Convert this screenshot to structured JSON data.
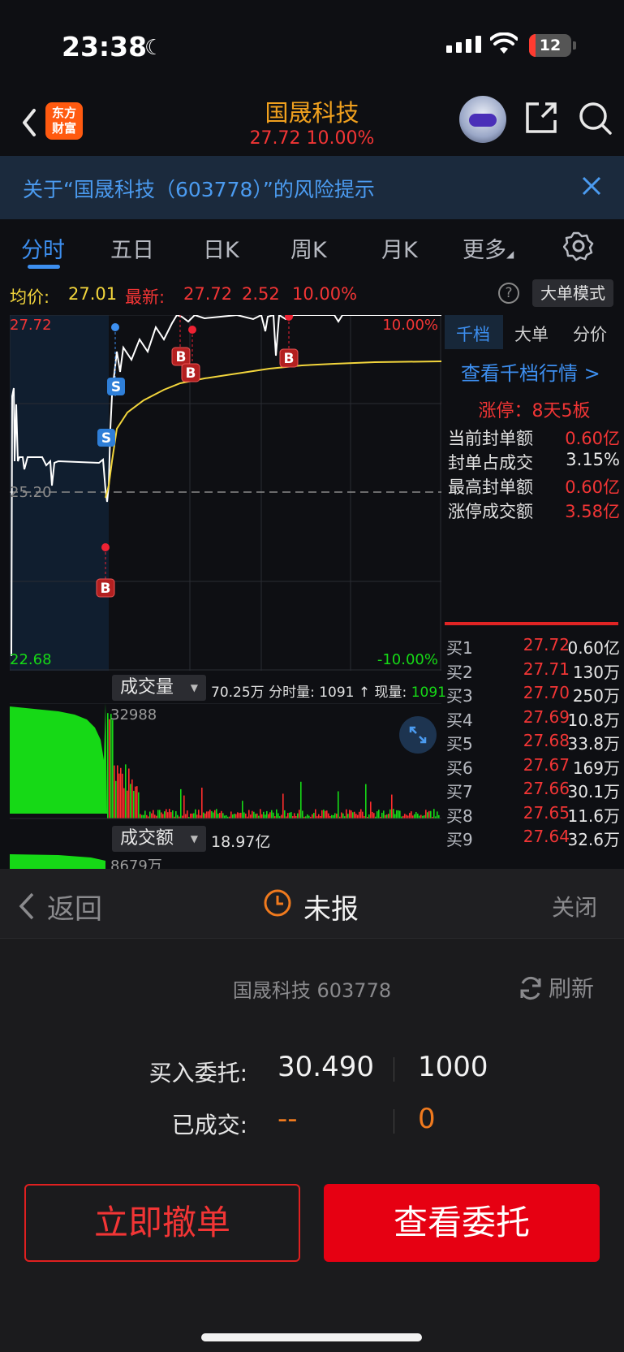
{
  "status_bar": {
    "time": "23:38",
    "battery": "12"
  },
  "nav": {
    "logo_line1": "东方",
    "logo_line2": "财富",
    "title": "国晟科技",
    "price_change": "27.72  10.00%"
  },
  "risk_banner": {
    "text": "关于“国晟科技（603778）”的风险提示"
  },
  "tabs": [
    {
      "label": "分时"
    },
    {
      "label": "五日"
    },
    {
      "label": "日K"
    },
    {
      "label": "周K"
    },
    {
      "label": "月K"
    },
    {
      "label": "更多"
    }
  ],
  "price_bar": {
    "avg_label": "均价:",
    "avg_value": "27.01",
    "latest_label": "最新:",
    "latest_value": "27.72",
    "change": "2.52",
    "pct": "10.00%",
    "help": "?",
    "mode_button": "大单模式"
  },
  "chart": {
    "high_price": "27.72",
    "high_pct": "10.00%",
    "ref_price": "25.20",
    "low_price": "22.68",
    "low_pct": "-10.00%",
    "colors": {
      "price_line": "#ffffff",
      "avg_line": "#f2d53c",
      "up": "#ff2d2d",
      "down": "#16d916"
    }
  },
  "volume": {
    "dropdown": "成交量",
    "total": "70.25万",
    "period_label": "分时量:",
    "period_value": "1091",
    "arrow": "↑",
    "now_label": "现量:",
    "now_value": "1091",
    "peak": "32988"
  },
  "amount": {
    "dropdown": "成交额",
    "total": "18.97亿",
    "peak": "8679万"
  },
  "right_panel": {
    "tabs": [
      "千档",
      "大单",
      "分价"
    ],
    "link": "查看千档行情 >",
    "limit_title": "涨停：8天5板",
    "stats": [
      {
        "k": "当前封单额",
        "v": "0.60亿",
        "red": true
      },
      {
        "k": "封单占成交",
        "v": "3.15%",
        "red": false
      },
      {
        "k": "最高封单额",
        "v": "0.60亿",
        "red": true
      },
      {
        "k": "涨停成交额",
        "v": "3.58亿",
        "red": true
      }
    ],
    "orderbook": [
      {
        "k": "买1",
        "p": "27.72",
        "q": "0.60亿"
      },
      {
        "k": "买2",
        "p": "27.71",
        "q": "130万"
      },
      {
        "k": "买3",
        "p": "27.70",
        "q": "250万"
      },
      {
        "k": "买4",
        "p": "27.69",
        "q": "10.8万"
      },
      {
        "k": "买5",
        "p": "27.68",
        "q": "33.8万"
      },
      {
        "k": "买6",
        "p": "27.67",
        "q": "169万"
      },
      {
        "k": "买7",
        "p": "27.66",
        "q": "30.1万"
      },
      {
        "k": "买8",
        "p": "27.65",
        "q": "11.6万"
      },
      {
        "k": "买9",
        "p": "27.64",
        "q": "32.6万"
      }
    ]
  },
  "sheet": {
    "back_label": "返回",
    "title": "未报",
    "close_label": "关闭",
    "stock": "国晟科技 603778",
    "refresh_label": "刷新",
    "order_label": "买入委托:",
    "order_price": "30.490",
    "order_qty": "1000",
    "filled_label": "已成交:",
    "filled_price": "--",
    "filled_qty": "0",
    "cancel_button": "立即撤单",
    "view_button": "查看委托"
  }
}
